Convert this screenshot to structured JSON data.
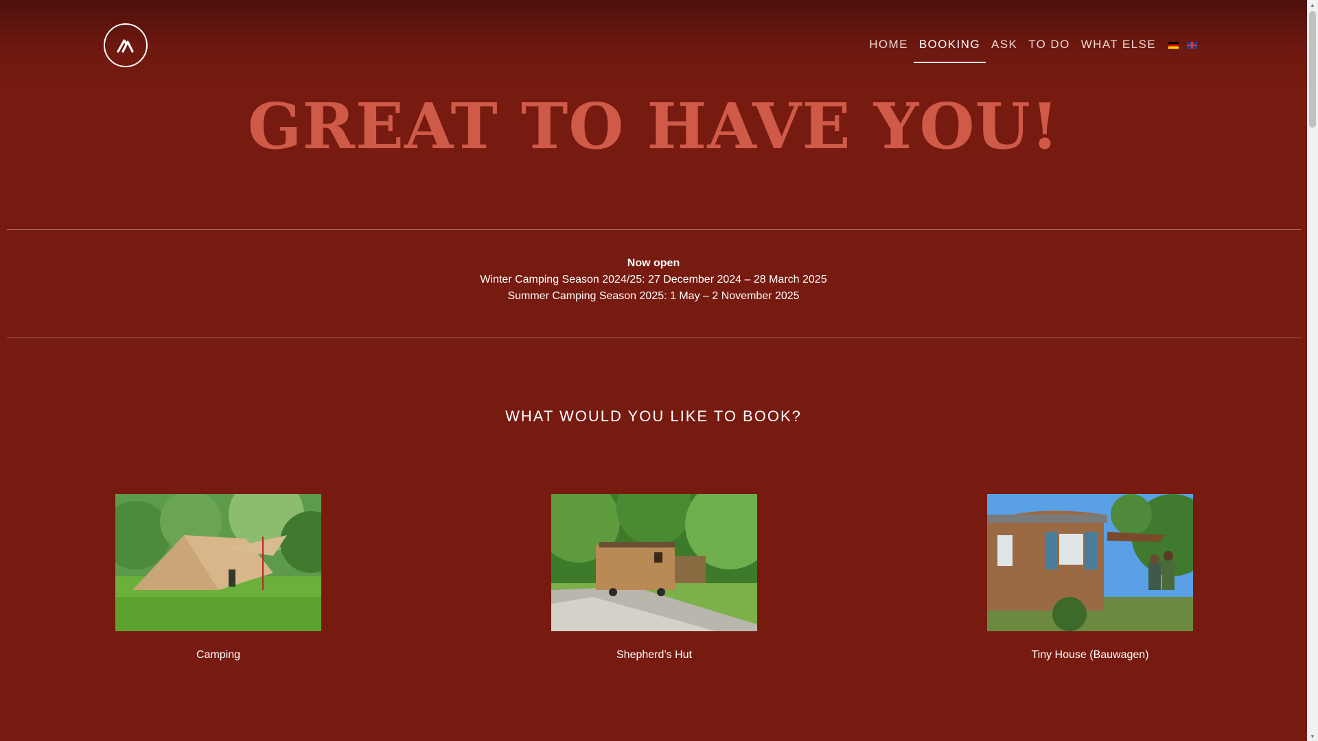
{
  "header": {
    "logo_icon": "mountain-logo-icon",
    "nav": [
      {
        "label": "HOME",
        "active": false
      },
      {
        "label": "BOOKING",
        "active": true
      },
      {
        "label": "ASK",
        "active": false
      },
      {
        "label": "TO DO",
        "active": false
      },
      {
        "label": "WHAT ELSE",
        "active": false
      }
    ],
    "languages": [
      "german-flag-icon",
      "english-flag-icon"
    ]
  },
  "hero": {
    "title": "GREAT TO HAVE YOU!"
  },
  "season": {
    "heading": "Now open",
    "winter": "Winter Camping Season 2024/25: 27 December 2024 – 28 March 2025",
    "summer": "Summer Camping Season 2025: 1 May – 2 November 2025"
  },
  "booking": {
    "heading": "WHAT WOULD YOU LIKE TO BOOK?",
    "options": [
      {
        "label": "Camping"
      },
      {
        "label": "Shepherd’s Hut"
      },
      {
        "label": "Tiny House (Bauwagen)"
      }
    ]
  },
  "colors": {
    "background": "#771a10",
    "title": "#cf5a48",
    "text": "#ffffff"
  }
}
